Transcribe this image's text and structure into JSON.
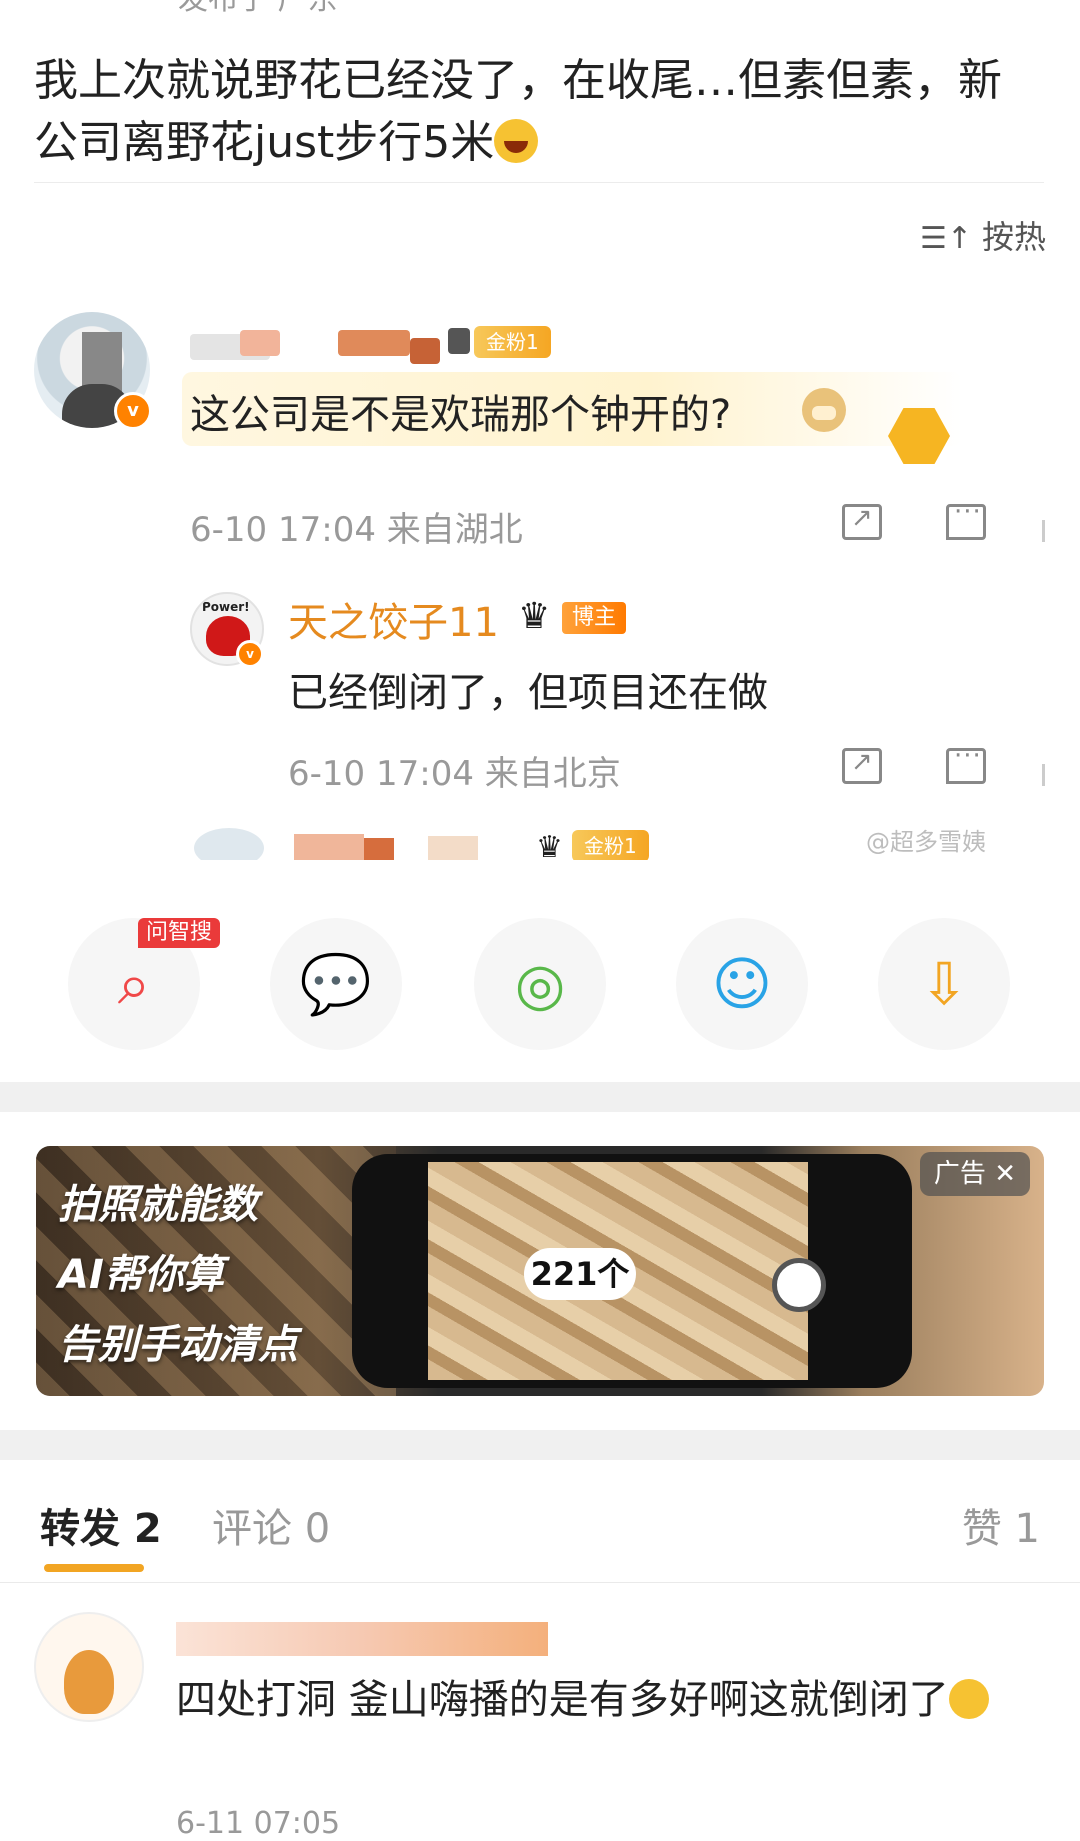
{
  "header": {
    "cut_text": "发布于 广东"
  },
  "post": {
    "text": "我上次就说野花已经没了，在收尾…但素但素，新公司离野花just步行5米"
  },
  "sort": {
    "label": "按热"
  },
  "comment1": {
    "fan_badge": "金粉1",
    "text": "这公司是不是欢瑞那个钟开的?",
    "meta": "6-10 17:04 来自湖北",
    "reply": {
      "name": "天之饺子11",
      "badge": "博主",
      "text": "已经倒闭了，但项目还在做",
      "meta": "6-10 17:04 来自北京"
    }
  },
  "comment2": {
    "fan_badge": "金粉1"
  },
  "watermark": "@超多雪姨",
  "share": {
    "wzs_tag": "问智搜",
    "items": [
      {
        "icon": "wenzhisou-search-icon",
        "color": "#f04848"
      },
      {
        "icon": "wechat-icon",
        "color": "#3bb84a"
      },
      {
        "icon": "moments-icon",
        "color": "#59b84a"
      },
      {
        "icon": "qq-icon",
        "color": "#29a3e6"
      },
      {
        "icon": "save-image-icon",
        "color": "#f2a523"
      }
    ]
  },
  "ad": {
    "lines": [
      "拍照就能数",
      "AI帮你算",
      "告别手动清点"
    ],
    "count_label": "221个",
    "tag": "广告"
  },
  "tabs": {
    "repost": "转发 2",
    "comment": "评论 0",
    "like": "赞 1"
  },
  "repost_item": {
    "text": "四处打洞 釜山嗨播的是有多好啊这就倒闭了",
    "meta": "6-11 07:05"
  }
}
